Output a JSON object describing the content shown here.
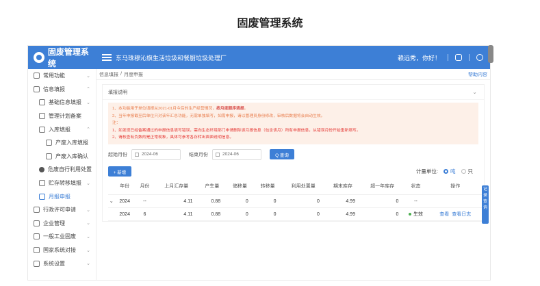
{
  "page_title": "固废管理系统",
  "header": {
    "logo_text": "固废管理系统",
    "factory": "东马珠穆沁旗生活垃圾和餐厨垃圾处理厂",
    "greeting": "赖远秀，你好！"
  },
  "sidebar": {
    "items": [
      {
        "label": "常用功能",
        "level": 0,
        "chev": "⌄"
      },
      {
        "label": "信息填报",
        "level": 0,
        "chev": "⌃"
      },
      {
        "label": "基础信息填报",
        "level": 1,
        "chev": "⌄"
      },
      {
        "label": "管理计划备案",
        "level": 1,
        "chev": ""
      },
      {
        "label": "入库填报",
        "level": 1,
        "chev": "⌃"
      },
      {
        "label": "产废入库填报",
        "level": 2,
        "chev": ""
      },
      {
        "label": "产废入库确认",
        "level": 2,
        "chev": ""
      },
      {
        "label": "危废自行利用处置",
        "level": 1,
        "chev": ""
      },
      {
        "label": "贮存转移填报",
        "level": 1,
        "chev": "⌄"
      },
      {
        "label": "月报申报",
        "level": 1,
        "chev": "",
        "active": true
      },
      {
        "label": "行政许可申请",
        "level": 0,
        "chev": "⌄"
      },
      {
        "label": "企业管理",
        "level": 0,
        "chev": "⌄"
      },
      {
        "label": "一般工业固废",
        "level": 0,
        "chev": "⌄"
      },
      {
        "label": "国家系统对接",
        "level": 0,
        "chev": "⌄"
      },
      {
        "label": "系统设置",
        "level": 0,
        "chev": "⌄"
      }
    ]
  },
  "breadcrumb": {
    "part1": "信息填报",
    "sep": "/",
    "part2": "月度申报",
    "help": "帮助内容"
  },
  "notice_card": {
    "title": "填报说明",
    "line1a": "1、本功能用于单位填报从2021-01月今后的生产经营情况，",
    "line1b": "按月度顺序填报",
    "line1c": "。",
    "line2": "2、当年申报截至后单位只对该年汇总功能，无需单独填写，如需申报，请以管理员身份修改，审核后数据将会自动生效。",
    "line3": "注：",
    "line4": "1、如发现已经备案通过的申报信息填写错误，需向生态环境部门申请删除该月报信息（包含该月）所有申报信息，从错误月份开始重新填写。",
    "line5": "2、请核查有负数的是正常现象，具体可参考各存转出面面说明信息。"
  },
  "filter": {
    "start_label": "起始月份",
    "start_value": "2024-06",
    "end_label": "结束月份",
    "end_value": "2024-06",
    "query_button": "Q 查询"
  },
  "toolbar": {
    "add_button": "+ 新增",
    "unit_label": "计量单位:",
    "unit_option1": "吨",
    "unit_option2": "只"
  },
  "table": {
    "headers": [
      "",
      "年份",
      "月份",
      "上月汇存量",
      "产生量",
      "储移量",
      "转移量",
      "利用处置量",
      "期末库存",
      "超一年库存",
      "状态",
      "操作"
    ],
    "rows": [
      {
        "expand": "⌄",
        "year": "2024",
        "month": "--",
        "prev": "4.11",
        "gen": "0.88",
        "store": "0",
        "transfer": "0",
        "use": "0",
        "end": "4.99",
        "over": "0",
        "status": "--",
        "ops": []
      },
      {
        "expand": "",
        "year": "2024",
        "month": "6",
        "prev": "4.11",
        "gen": "0.88",
        "store": "0",
        "transfer": "0",
        "use": "0",
        "end": "4.99",
        "over": "0",
        "status": "生效",
        "ops": [
          "查看",
          "查看日志"
        ]
      }
    ]
  },
  "side_tab": {
    "text": "记录查询"
  },
  "colors": {
    "primary": "#3d7fd6",
    "notice_bg": "#fdf0e8",
    "notice_text": "#e87b4a",
    "success": "#4caf50"
  }
}
